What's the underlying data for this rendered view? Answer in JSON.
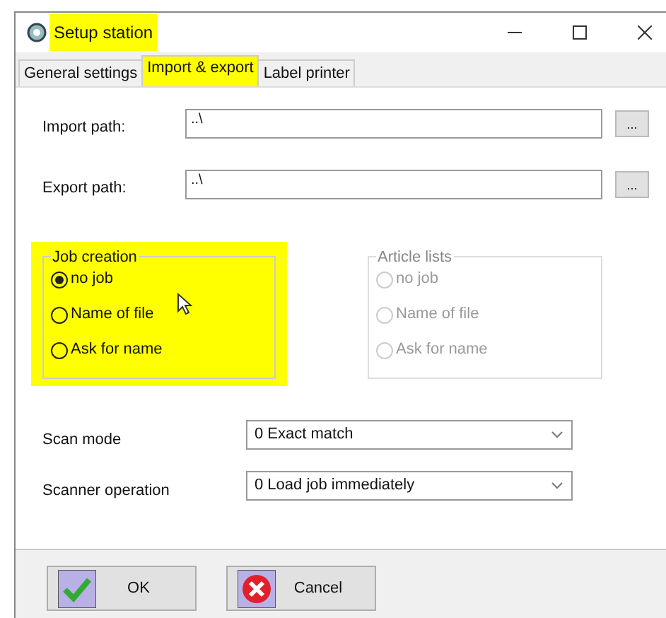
{
  "window": {
    "title": "Setup station",
    "title_highlighted": true
  },
  "tabs": [
    {
      "label": "General settings",
      "selected": false,
      "highlighted": false
    },
    {
      "label": "Import & export",
      "selected": true,
      "highlighted": true
    },
    {
      "label": "Label printer",
      "selected": false,
      "highlighted": false
    }
  ],
  "paths": [
    {
      "label": "Import path:",
      "value": "..\\",
      "button": "..."
    },
    {
      "label": "Export path:",
      "value": "..\\",
      "button": "..."
    }
  ],
  "groups": [
    {
      "title": "Job creation",
      "disabled": false,
      "highlighted": true,
      "options": [
        {
          "label": "no job",
          "selected": true
        },
        {
          "label": "Name of file",
          "selected": false
        },
        {
          "label": "Ask for name",
          "selected": false
        }
      ]
    },
    {
      "title": "Article lists",
      "disabled": true,
      "highlighted": false,
      "options": [
        {
          "label": "no job",
          "selected": false
        },
        {
          "label": "Name of file",
          "selected": false
        },
        {
          "label": "Ask for name",
          "selected": false
        }
      ]
    }
  ],
  "combos": [
    {
      "label": "Scan mode",
      "value": "0 Exact match"
    },
    {
      "label": "Scanner operation",
      "value": "0 Load job immediately"
    }
  ],
  "buttons": [
    {
      "label": "OK",
      "kind": "ok"
    },
    {
      "label": "Cancel",
      "kind": "cancel"
    }
  ]
}
